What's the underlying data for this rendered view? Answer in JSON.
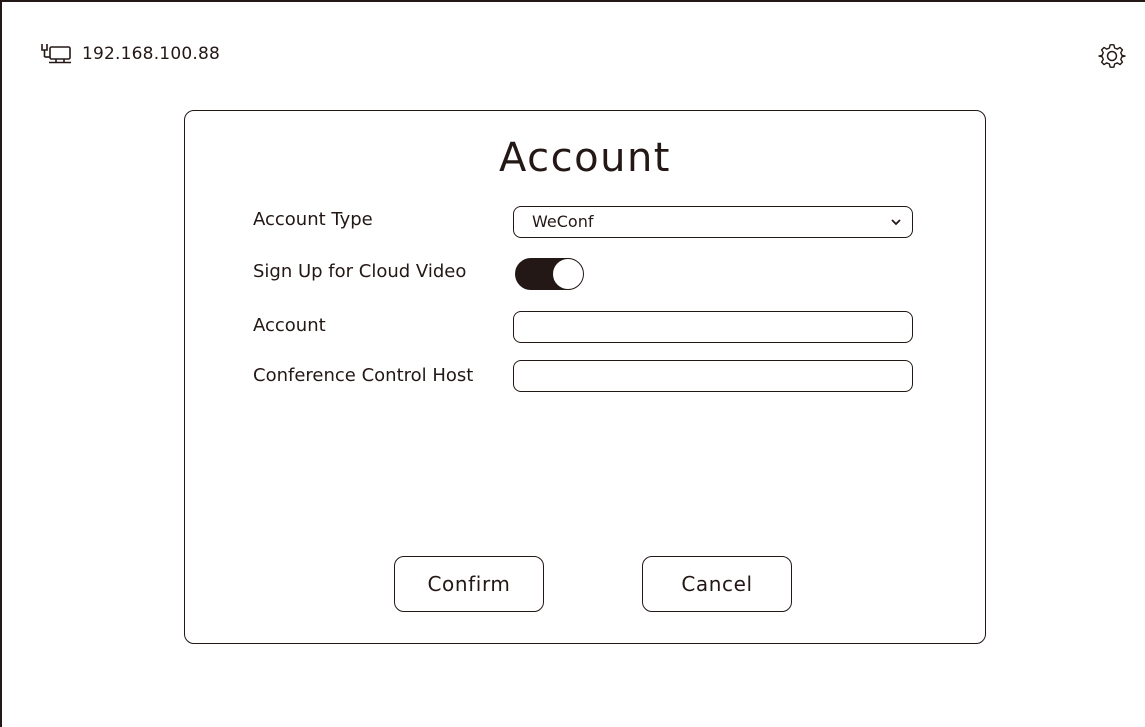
{
  "status_bar": {
    "network_icon": "ethernet-network-icon",
    "ip_address": "192.168.100.88",
    "settings_icon": "gear-icon"
  },
  "dialog": {
    "title": "Account",
    "account_type": {
      "label": "Account Type",
      "value": "WeConf",
      "chevron_icon": "chevron-down-icon"
    },
    "cloud_video": {
      "label": "Sign Up for Cloud Video",
      "enabled": true
    },
    "account": {
      "label": "Account",
      "value": ""
    },
    "conference_host": {
      "label": "Conference Control Host",
      "value": ""
    },
    "confirm_label": "Confirm",
    "cancel_label": "Cancel"
  },
  "colors": {
    "ink": "#231815",
    "background": "#ffffff"
  }
}
